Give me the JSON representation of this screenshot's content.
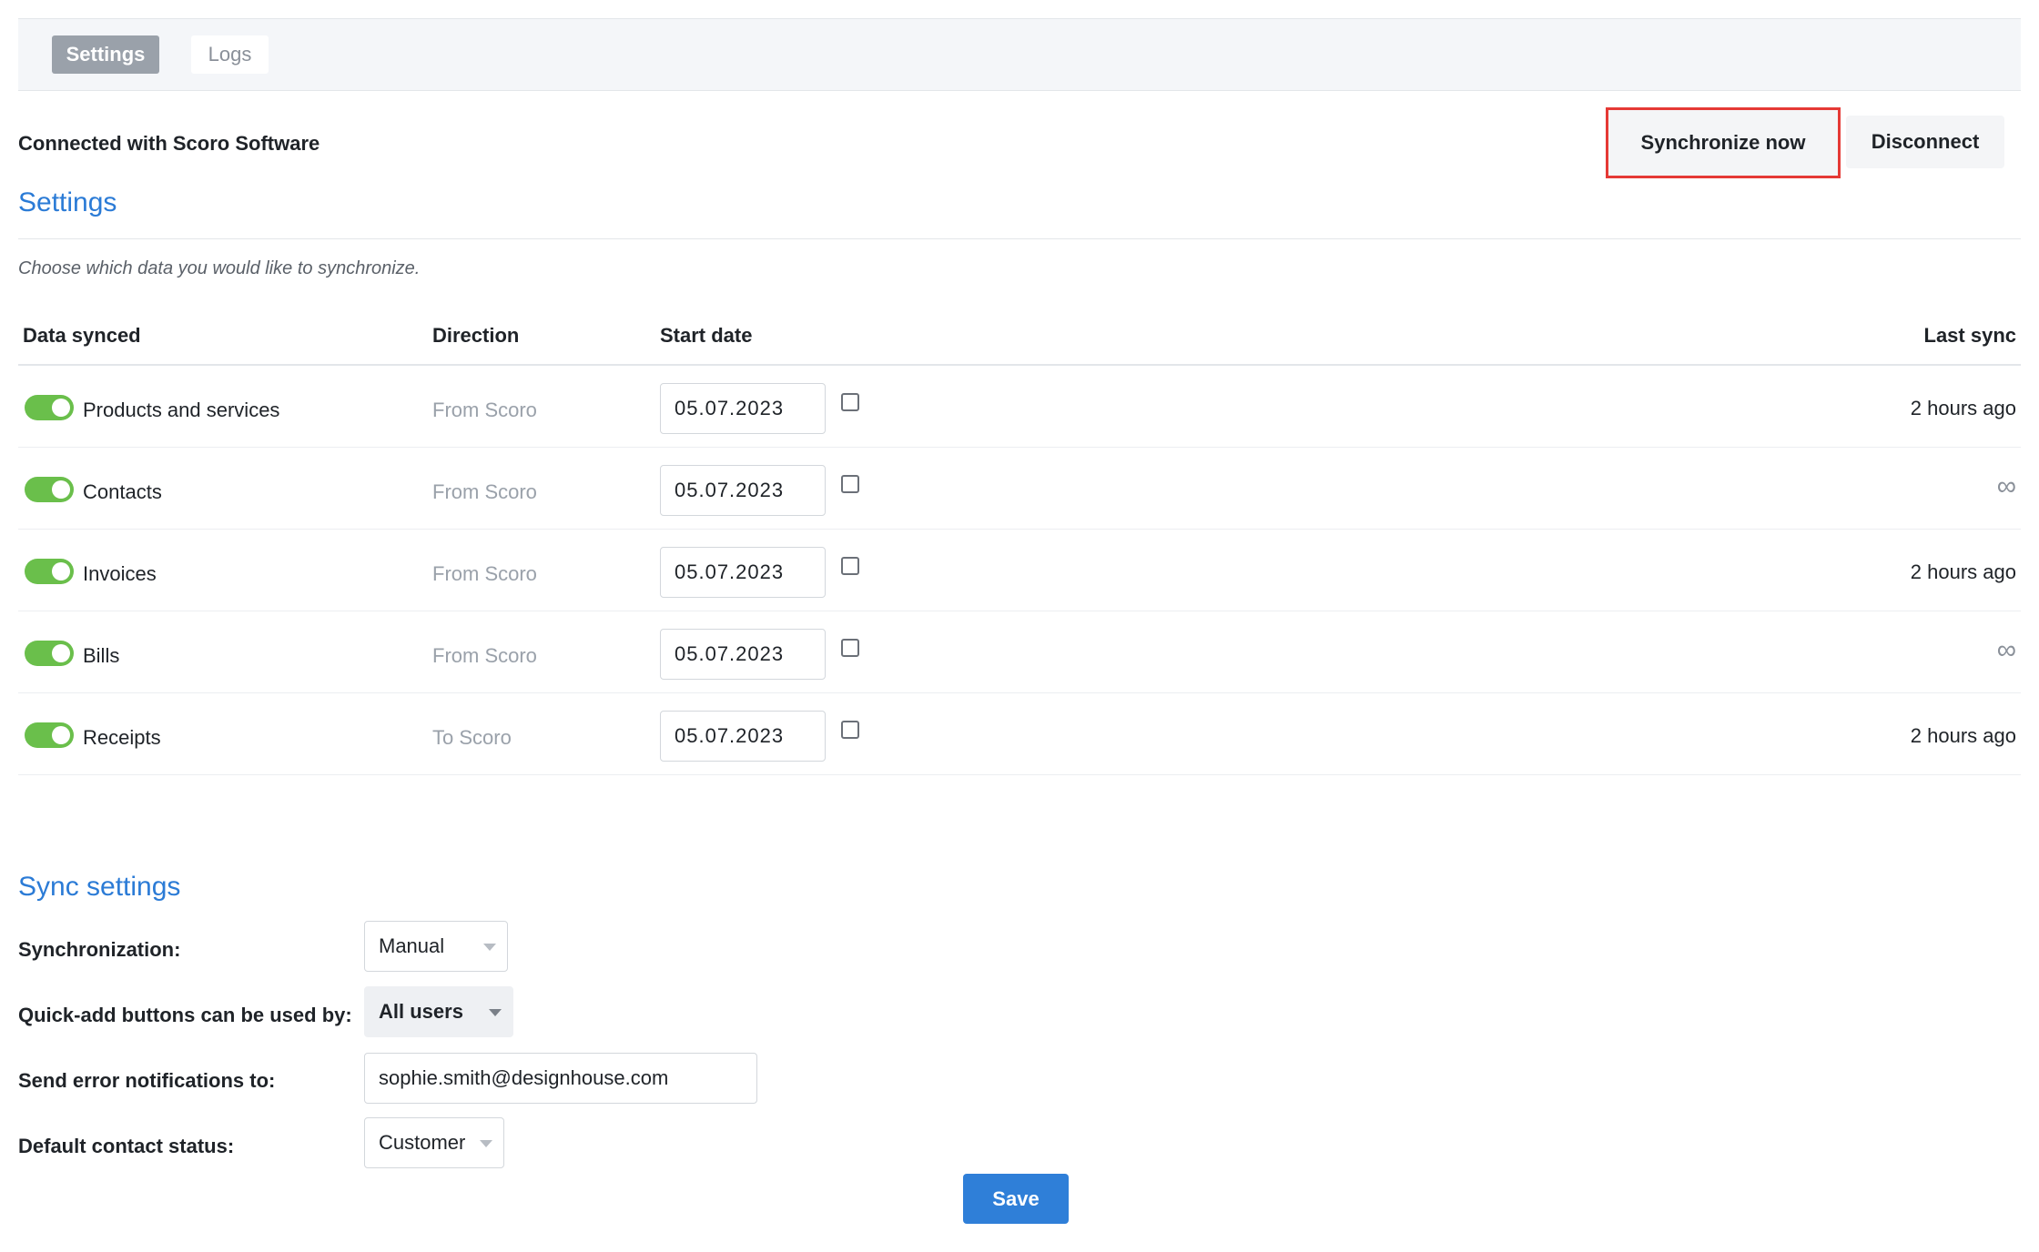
{
  "tabs": [
    {
      "label": "Settings",
      "active": true
    },
    {
      "label": "Logs",
      "active": false
    }
  ],
  "header": {
    "connected_text": "Connected with Scoro Software",
    "sync_button": "Synchronize now",
    "disconnect_button": "Disconnect"
  },
  "settings": {
    "title": "Settings",
    "subtitle": "Choose which data you would like to synchronize.",
    "columns": {
      "data_synced": "Data synced",
      "direction": "Direction",
      "start_date": "Start date",
      "last_sync": "Last sync"
    },
    "rows": [
      {
        "label": "Products and services",
        "direction": "From Scoro",
        "start_date": "05.07.2023",
        "last_sync": "2 hours ago",
        "enabled": true
      },
      {
        "label": "Contacts",
        "direction": "From Scoro",
        "start_date": "05.07.2023",
        "last_sync": "∞",
        "enabled": true
      },
      {
        "label": "Invoices",
        "direction": "From Scoro",
        "start_date": "05.07.2023",
        "last_sync": "2 hours ago",
        "enabled": true
      },
      {
        "label": "Bills",
        "direction": "From Scoro",
        "start_date": "05.07.2023",
        "last_sync": "∞",
        "enabled": true
      },
      {
        "label": "Receipts",
        "direction": "To Scoro",
        "start_date": "05.07.2023",
        "last_sync": "2 hours ago",
        "enabled": true
      }
    ]
  },
  "sync_settings": {
    "title": "Sync settings",
    "synchronization_label": "Synchronization:",
    "synchronization_value": "Manual",
    "quick_add_label": "Quick-add buttons can be used by:",
    "quick_add_value": "All users",
    "error_notifications_label": "Send error notifications to:",
    "error_notifications_value": "sophie.smith@designhouse.com",
    "default_status_label": "Default contact status:",
    "default_status_value": "Customer",
    "save_button": "Save"
  },
  "colors": {
    "accent": "#2b7bd6",
    "toggle_on": "#6abf4b",
    "highlight_border": "#e53935",
    "save_button": "#2f7fd8"
  }
}
